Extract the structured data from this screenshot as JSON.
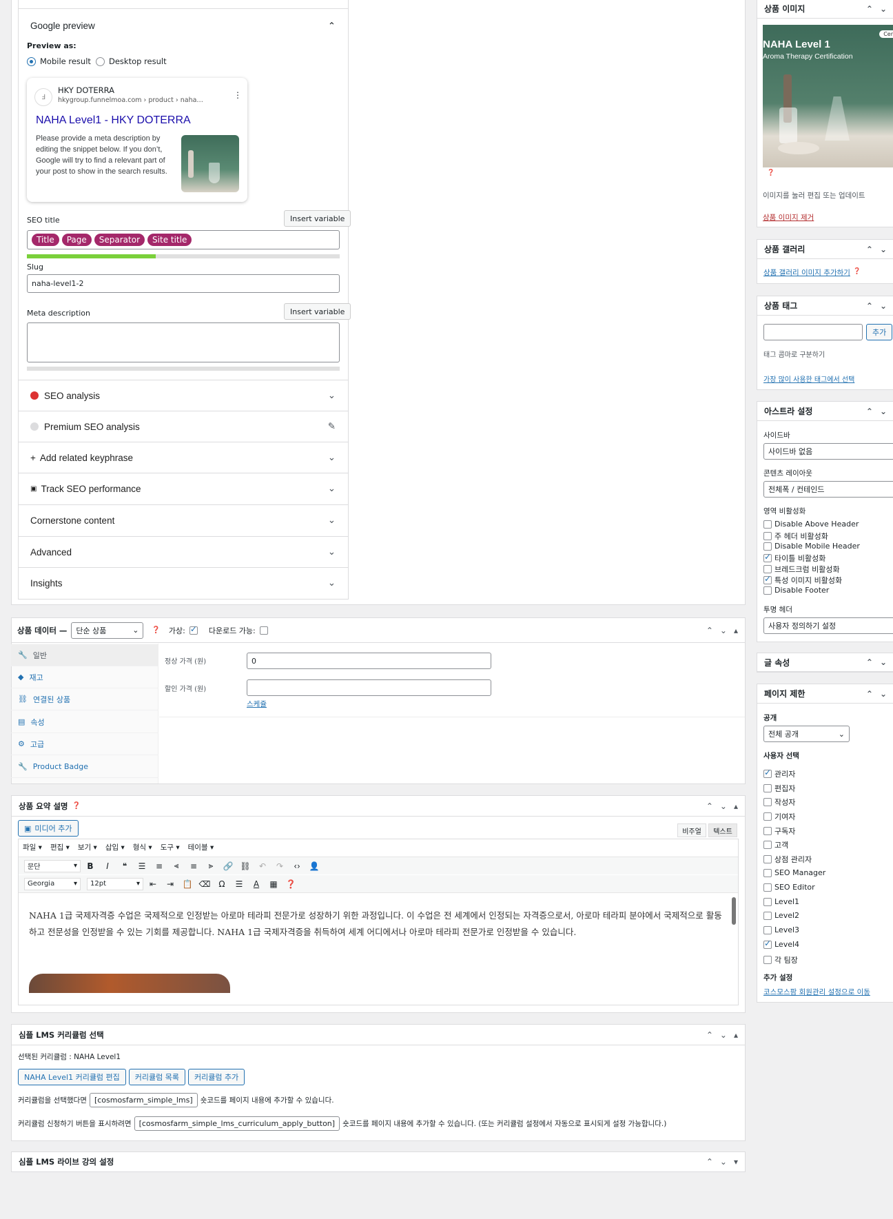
{
  "yoast": {
    "google_preview": "Google preview",
    "preview_as": "Preview as:",
    "mobile": "Mobile result",
    "desktop": "Desktop result",
    "card_site": "HKY DOTERRA",
    "card_url": "hkygroup.funnelmoa.com › product › naha…",
    "card_title": "NAHA Level1 - HKY DOTERRA",
    "card_desc": "Please provide a meta description by editing the snippet below. If you don’t, Google will try to find a relevant part of your post to show in the search results.",
    "seo_title": "SEO title",
    "insert_variable": "Insert variable",
    "pills": [
      "Title",
      "Page",
      "Separator",
      "Site title"
    ],
    "slug_label": "Slug",
    "slug_value": "naha-level1-2",
    "meta_desc": "Meta description",
    "sections": [
      "SEO analysis",
      "Premium SEO analysis",
      "Add related keyphrase",
      "Track SEO performance",
      "Cornerstone content",
      "Advanced",
      "Insights"
    ]
  },
  "product_data": {
    "title": "상품 데이터 —",
    "type": "단순 상품",
    "virtual": "가상:",
    "downloadable": "다운로드 가능:",
    "tabs": [
      "일반",
      "재고",
      "연결된 상품",
      "속성",
      "고급",
      "Product Badge"
    ],
    "regular_price_label": "정상 가격 (원)",
    "regular_price": "0",
    "sale_price_label": "할인 가격 (원)",
    "schedule": "스케쥴"
  },
  "summary": {
    "title": "상품 요약 설명",
    "add_media": "미디어 추가",
    "visual": "비주얼",
    "text": "텍스트",
    "menus": [
      "파일 ▾",
      "편집 ▾",
      "보기 ▾",
      "삽입 ▾",
      "형식 ▾",
      "도구 ▾",
      "테이블 ▾"
    ],
    "format": "문단",
    "font": "Georgia",
    "size": "12pt",
    "body": "NAHA 1급 국제자격증 수업은 국제적으로 인정받는 아로마 테라피 전문가로 성장하기 위한 과정입니다. 이 수업은 전 세계에서 인정되는 자격증으로서, 아로마 테라피 분야에서 국제적으로 활동하고 전문성을 인정받을 수 있는 기회를 제공합니다. NAHA 1급 국제자격증을 취득하여 세계 어디에서나 아로마 테라피 전문가로 인정받을 수 있습니다."
  },
  "lms": {
    "title": "심플 LMS 커리큘럼 선택",
    "selected": "선택된 커리큘럼 : NAHA Level1",
    "buttons": [
      "NAHA Level1 커리큘럼 편집",
      "커리큘럼 목록",
      "커리큘럼 추가"
    ],
    "line1_pre": "커리큘럼을 선택했다면",
    "shortcode1": "[cosmosfarm_simple_lms]",
    "line1_post": "숏코드를 페이지 내용에 추가할 수 있습니다.",
    "line2_pre": "커리큘럼 신청하기 버튼을 표시하려면",
    "shortcode2": "[cosmosfarm_simple_lms_curriculum_apply_button]",
    "line2_post": "숏코드를 페이지 내용에 추가할 수 있습니다. (또는 커리큘럼 설정에서 자동으로 표시되게 설정 가능합니다.)",
    "live_title": "심플 LMS 라이브 강의 설정"
  },
  "sidebar": {
    "image_title": "상품 이미지",
    "image_caption_1": "NAHA Level 1",
    "image_caption_2": "Aroma Therapy Certification",
    "image_badge": "Cer",
    "image_hint": "이미지를 눌러 편집 또는 업데이트",
    "image_remove": "상품 이미지 제거",
    "gallery_title": "상품 갤러리",
    "gallery_add": "상품 갤러리 이미지 추가하기",
    "tags_title": "상품 태그",
    "tags_add": "추가",
    "tags_hint": "태그 콤마로 구분하기",
    "tags_popular": "가장 많이 사용한 태그에서 선택",
    "astra_title": "아스트라 설정",
    "sidebar_label": "사이드바",
    "sidebar_value": "사이드바 없음",
    "layout_label": "콘텐츠 레이아웃",
    "layout_value": "전체폭 / 컨테인드",
    "disable_label": "영역 비활성화",
    "disable_items": [
      {
        "label": "Disable Above Header",
        "checked": false
      },
      {
        "label": "주 헤더 비활성화",
        "checked": false
      },
      {
        "label": "Disable Mobile Header",
        "checked": false
      },
      {
        "label": "타이틀 비활성화",
        "checked": true
      },
      {
        "label": "브레드크럼 비활성화",
        "checked": false
      },
      {
        "label": "특성 이미지 비활성화",
        "checked": true
      },
      {
        "label": "Disable Footer",
        "checked": false
      }
    ],
    "transparent_label": "투명 헤더",
    "transparent_value": "사용자 정의하기 설정",
    "attributes_title": "글 속성",
    "restrict_title": "페이지 제한",
    "public_label": "공개",
    "public_value": "전체 공개",
    "users_label": "사용자 선택",
    "users": [
      {
        "label": "관리자",
        "checked": true
      },
      {
        "label": "편집자",
        "checked": false
      },
      {
        "label": "작성자",
        "checked": false
      },
      {
        "label": "기여자",
        "checked": false
      },
      {
        "label": "구독자",
        "checked": false
      },
      {
        "label": "고객",
        "checked": false
      },
      {
        "label": "상점 관리자",
        "checked": false
      },
      {
        "label": "SEO Manager",
        "checked": false
      },
      {
        "label": "SEO Editor",
        "checked": false
      },
      {
        "label": "Level1",
        "checked": false
      },
      {
        "label": "Level2",
        "checked": false
      },
      {
        "label": "Level3",
        "checked": false
      },
      {
        "label": "Level4",
        "checked": true
      },
      {
        "label": "각 팀장",
        "checked": false
      }
    ],
    "extra_label": "추가 설정",
    "extra_link": "코스모스팜 회원관리 설정으로 이동"
  },
  "colors": {
    "accent": "#2271b1",
    "yoast": "#a4286a",
    "green": "#7ad03a"
  }
}
